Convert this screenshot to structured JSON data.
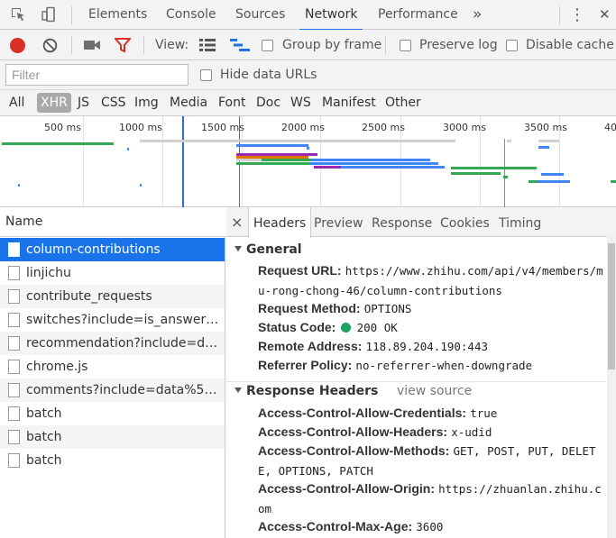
{
  "tabs": {
    "elements": "Elements",
    "console": "Console",
    "sources": "Sources",
    "network": "Network",
    "performance": "Performance",
    "more": "»",
    "menu": "⋮",
    "close": "✕"
  },
  "toolbar": {
    "view_label": "View:",
    "group_by_frame": "Group by frame",
    "preserve_log": "Preserve log",
    "disable_cache": "Disable cache"
  },
  "filter": {
    "placeholder": "Filter",
    "hide_data_urls": "Hide data URLs"
  },
  "type_filters": [
    "All",
    "XHR",
    "JS",
    "CSS",
    "Img",
    "Media",
    "Font",
    "Doc",
    "WS",
    "Manifest",
    "Other"
  ],
  "overview": {
    "ticks": [
      "500 ms",
      "1000 ms",
      "1500 ms",
      "2000 ms",
      "2500 ms",
      "3000 ms",
      "3500 ms",
      "40"
    ]
  },
  "requests": {
    "header": "Name",
    "items": [
      "column-contributions",
      "linjichu",
      "contribute_requests",
      "switches?include=is_answer_re...",
      "recommendation?include=dat...",
      "chrome.js",
      "comments?include=data%5B*...",
      "batch",
      "batch",
      "batch"
    ]
  },
  "detail": {
    "close": "×",
    "tabs": [
      "Headers",
      "Preview",
      "Response",
      "Cookies",
      "Timing"
    ],
    "general": {
      "title": "General",
      "request_url_k": "Request URL:",
      "request_url_v": "https://www.zhihu.com/api/v4/members/mu-rong-chong-46/column-contributions",
      "method_k": "Request Method:",
      "method_v": "OPTIONS",
      "status_k": "Status Code:",
      "status_v": "200 OK",
      "status_color": "#1aa260",
      "remote_k": "Remote Address:",
      "remote_v": "118.89.204.190:443",
      "referrer_k": "Referrer Policy:",
      "referrer_v": "no-referrer-when-downgrade"
    },
    "response_headers": {
      "title": "Response Headers",
      "view_source": "view source",
      "allow_credentials_k": "Access-Control-Allow-Credentials:",
      "allow_credentials_v": "true",
      "allow_headers_k": "Access-Control-Allow-Headers:",
      "allow_headers_v": "x-udid",
      "allow_methods_k": "Access-Control-Allow-Methods:",
      "allow_methods_v": "GET, POST, PUT, DELETE, OPTIONS, PATCH",
      "allow_origin_k": "Access-Control-Allow-Origin:",
      "allow_origin_v": "https://zhuanlan.zhihu.com",
      "max_age_k": "Access-Control-Max-Age:",
      "max_age_v": "3600"
    }
  },
  "colors": {
    "accent": "#1a73e8",
    "record": "#d93025",
    "filter_icon": "#d93025"
  }
}
